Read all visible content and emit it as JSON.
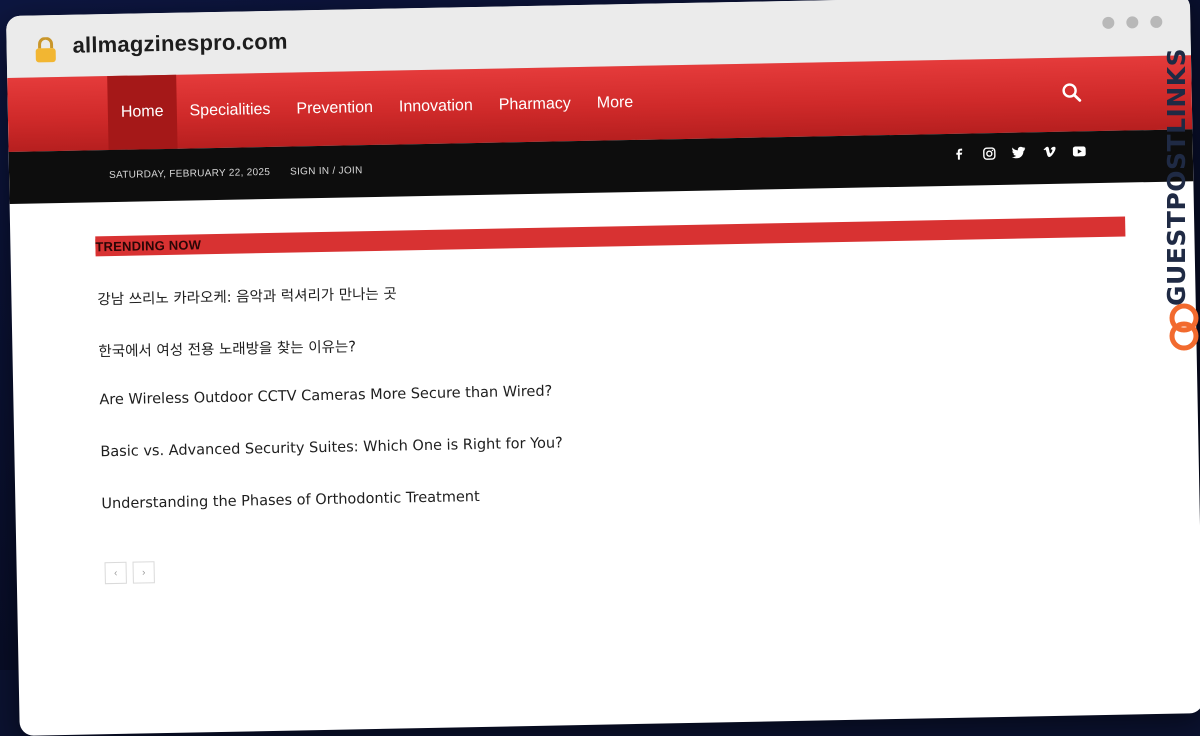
{
  "browser": {
    "url": "allmagzinespro.com"
  },
  "nav": {
    "items": [
      {
        "label": "Home"
      },
      {
        "label": "Specialities"
      },
      {
        "label": "Prevention"
      },
      {
        "label": "Innovation"
      },
      {
        "label": "Pharmacy"
      },
      {
        "label": "More"
      }
    ]
  },
  "topbar": {
    "date": "SATURDAY, FEBRUARY 22, 2025",
    "signin": "SIGN IN / JOIN",
    "socials": [
      "facebook-icon",
      "instagram-icon",
      "twitter-icon",
      "vimeo-icon",
      "youtube-icon"
    ]
  },
  "trending": {
    "title": "TRENDING NOW",
    "items": [
      {
        "title": "강남 쓰리노 카라오케: 음악과 럭셔리가 만나는 곳"
      },
      {
        "title": "한국에서 여성 전용 노래방을 찾는 이유는?"
      },
      {
        "title": "Are Wireless Outdoor CCTV Cameras More Secure than Wired?"
      },
      {
        "title": "Basic vs. Advanced Security Suites: Which One is Right for You?"
      },
      {
        "title": "Understanding the Phases of Orthodontic Treatment"
      }
    ],
    "prev": "‹",
    "next": "›"
  },
  "watermark": {
    "text": "GUESTPOSTLINKS"
  },
  "colors": {
    "accent": "#d83232",
    "nav_active": "#a51818",
    "topbar": "#0d0d0d",
    "watermark_orange": "#f26a2e"
  }
}
